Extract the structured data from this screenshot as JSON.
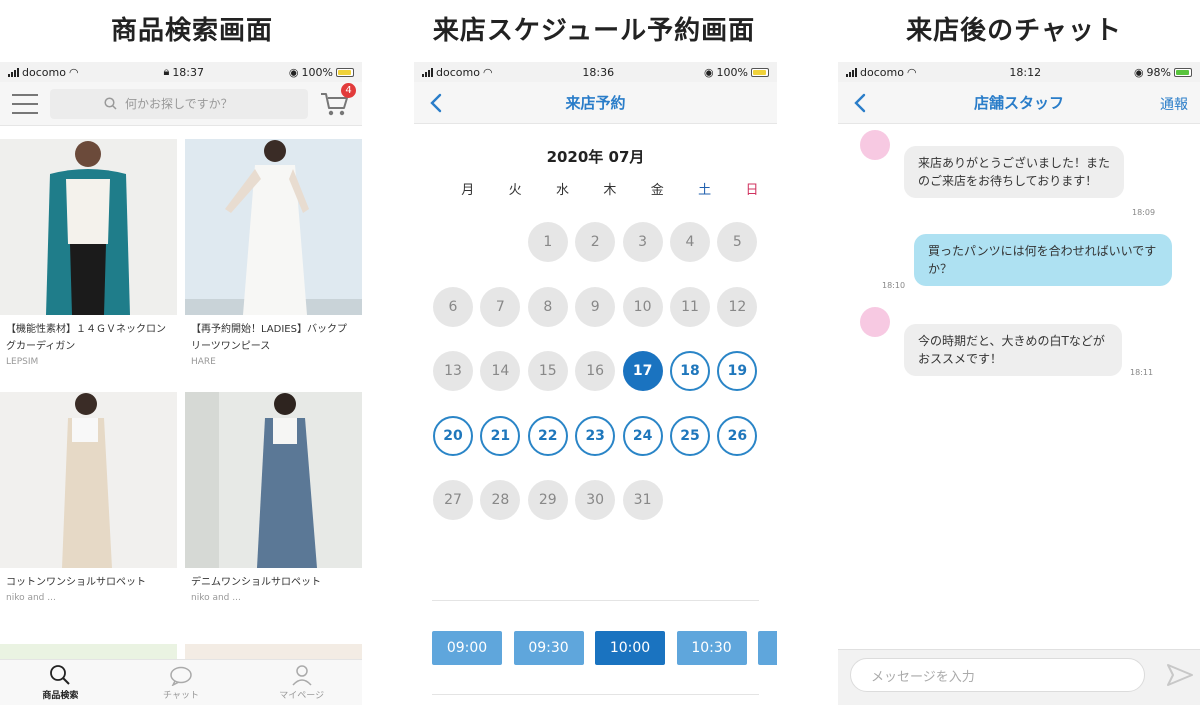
{
  "captions": {
    "search": "商品検索画面",
    "reservation": "来店スケジュール予約画面",
    "chat": "来店後のチャット"
  },
  "search_screen": {
    "status": {
      "carrier": "docomo",
      "time": "18:37",
      "battery": "100%"
    },
    "search_placeholder": "何かお探しですか？",
    "cart_badge": "4",
    "products": [
      {
        "title": "【機能性素材】１４ＧＶネックロングカーディガン",
        "brand": "LEPSIM"
      },
      {
        "title": "【再予約開始！LADIES】バックプリーツワンピース",
        "brand": "HARE"
      },
      {
        "title": "コットンワンショルサロペット",
        "brand": "niko and ..."
      },
      {
        "title": "デニムワンショルサロペット",
        "brand": "niko and ..."
      }
    ],
    "tabs": {
      "search": "商品検索",
      "chat": "チャット",
      "mypage": "マイページ"
    }
  },
  "reservation_screen": {
    "status": {
      "carrier": "docomo",
      "time": "18:36",
      "battery": "100%"
    },
    "title": "来店予約",
    "month": "2020年 07月",
    "weekdays": [
      "月",
      "火",
      "水",
      "木",
      "金",
      "土",
      "日"
    ],
    "days": {
      "past": [
        "1",
        "2",
        "3",
        "4",
        "5",
        "6",
        "7",
        "8",
        "9",
        "10",
        "11",
        "12",
        "13",
        "14",
        "15",
        "16",
        "27",
        "28",
        "29",
        "30",
        "31"
      ],
      "selected": "17",
      "available": [
        "18",
        "19",
        "20",
        "21",
        "22",
        "23",
        "24",
        "25",
        "26"
      ]
    },
    "time_slots": [
      "09:00",
      "09:30",
      "10:00",
      "10:30"
    ],
    "selected_slot": "10:00",
    "colors": {
      "accent": "#1a73c0",
      "available_border": "#2a85c7"
    }
  },
  "chat_screen": {
    "status": {
      "carrier": "docomo",
      "time": "18:12",
      "battery": "98%"
    },
    "title": "店舗スタッフ",
    "report": "通報",
    "messages": [
      {
        "from": "staff",
        "text": "来店ありがとうございました！またのご来店をお待ちしております！",
        "time": "18:09"
      },
      {
        "from": "user",
        "text": "買ったパンツには何を合わせればいいですか？",
        "time": "18:10"
      },
      {
        "from": "staff",
        "text": "今の時期だと、大きめの白Tなどがおススメです！",
        "time": "18:11"
      }
    ],
    "input_placeholder": "メッセージを入力"
  }
}
